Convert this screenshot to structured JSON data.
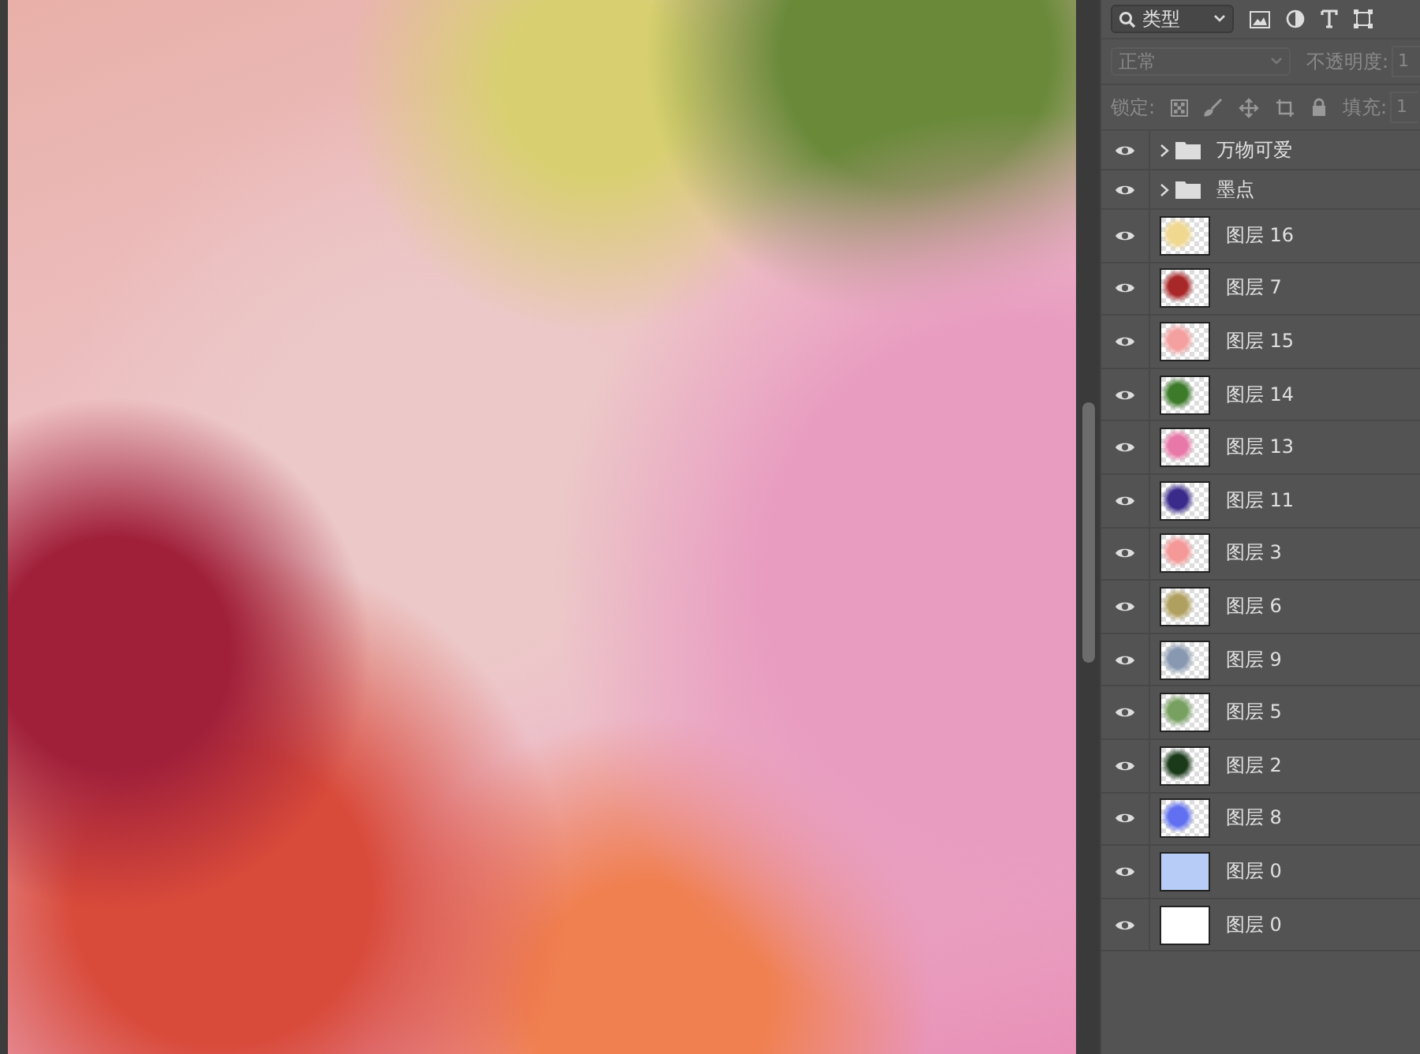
{
  "filter": {
    "value": "类型"
  },
  "blend": {
    "value": "正常",
    "disabled": true
  },
  "opacity": {
    "label": "不透明度:",
    "value": "1"
  },
  "lock": {
    "label": "锁定:"
  },
  "fill": {
    "label": "填充:",
    "value": "1"
  },
  "layers": [
    {
      "kind": "group",
      "name": "万物可爱",
      "visible": true,
      "expanded": false
    },
    {
      "kind": "group",
      "name": "墨点",
      "visible": true,
      "expanded": false
    },
    {
      "kind": "layer",
      "name": "图层 16",
      "visible": true,
      "transparent": true,
      "color": "#f0d890"
    },
    {
      "kind": "layer",
      "name": "图层 7",
      "visible": true,
      "transparent": true,
      "color": "#a8282a"
    },
    {
      "kind": "layer",
      "name": "图层 15",
      "visible": true,
      "transparent": true,
      "color": "#f4a0a0"
    },
    {
      "kind": "layer",
      "name": "图层 14",
      "visible": true,
      "transparent": true,
      "color": "#3d7a2a"
    },
    {
      "kind": "layer",
      "name": "图层 13",
      "visible": true,
      "transparent": true,
      "color": "#e878a8"
    },
    {
      "kind": "layer",
      "name": "图层 11",
      "visible": true,
      "transparent": true,
      "color": "#3a2a8a"
    },
    {
      "kind": "layer",
      "name": "图层 3",
      "visible": true,
      "transparent": true,
      "color": "#f49898"
    },
    {
      "kind": "layer",
      "name": "图层 6",
      "visible": true,
      "transparent": true,
      "color": "#b0a060"
    },
    {
      "kind": "layer",
      "name": "图层 9",
      "visible": true,
      "transparent": true,
      "color": "#8898b0"
    },
    {
      "kind": "layer",
      "name": "图层 5",
      "visible": true,
      "transparent": true,
      "color": "#78a060"
    },
    {
      "kind": "layer",
      "name": "图层 2",
      "visible": true,
      "transparent": true,
      "color": "#1a3a1a"
    },
    {
      "kind": "layer",
      "name": "图层 8",
      "visible": true,
      "transparent": true,
      "color": "#6070f0"
    },
    {
      "kind": "layer",
      "name": "图层 0",
      "visible": true,
      "transparent": false,
      "color": "#b8ccf8"
    },
    {
      "kind": "layer",
      "name": "图层 0",
      "visible": true,
      "transparent": false,
      "color": "#ffffff"
    }
  ]
}
